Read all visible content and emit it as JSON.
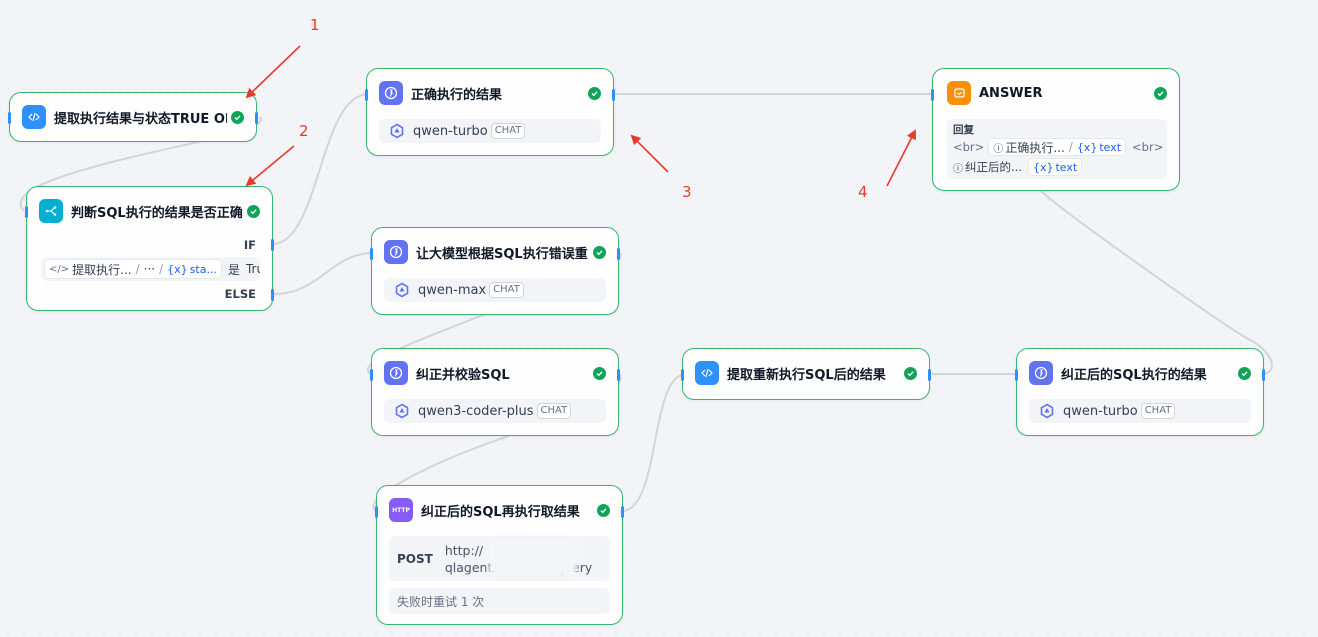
{
  "nodes": {
    "extract_result": {
      "title": "提取执行结果与状态TRUE OI",
      "icon": "code-icon"
    },
    "judge": {
      "title": "判断SQL执行的结果是否正确",
      "if_label": "IF",
      "else_label": "ELSE",
      "condition": {
        "var_node": "提取执行...",
        "var_path": "···",
        "var_name": "sta...",
        "operator": "是",
        "value": "True"
      }
    },
    "correct_result": {
      "title": "正确执行的结果",
      "model": "qwen-turbo",
      "mode": "CHAT"
    },
    "regen": {
      "title": "让大模型根据SQL执行错误重",
      "model": "qwen-max",
      "mode": "CHAT"
    },
    "fix_sql": {
      "title": "纠正并校验SQL",
      "model": "qwen3-coder-plus",
      "mode": "CHAT"
    },
    "http": {
      "title": "纠正后的SQL再执行取结果",
      "icon_text": "HTTP",
      "method": "POST",
      "url_line1": "http://                    /s",
      "url_line2": "qlagent/               query",
      "retry": "失败时重试 1 次"
    },
    "extract_rerun": {
      "title": "提取重新执行SQL后的结果",
      "icon": "code-icon"
    },
    "fixed_result": {
      "title": "纠正后的SQL执行的结果",
      "model": "qwen-turbo",
      "mode": "CHAT"
    },
    "answer": {
      "title": "ANSWER",
      "sub": "回复",
      "br": "<br>",
      "ref1_node": "正确执行...",
      "ref1_var": "text",
      "ref2_node": "纠正后的...",
      "ref2_var": "text"
    }
  },
  "annotations": [
    "1",
    "2",
    "3",
    "4"
  ],
  "colors": {
    "node_border": "#35b56f",
    "success": "#12a35a",
    "port": "#2e90fa",
    "edge": "#d0d5dd",
    "annotation": "#e8392b"
  }
}
